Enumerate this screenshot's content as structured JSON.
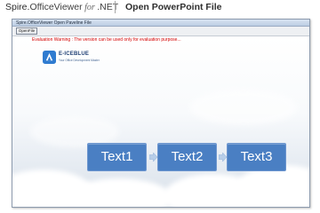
{
  "page": {
    "brand": {
      "part1": "Spire.",
      "part2": "OfficeViewer",
      "part3": " for ",
      "part4": ".NET"
    },
    "title": "Open PowerPoint File"
  },
  "window": {
    "title": "Spire.OfficeViewer Open Paveline File"
  },
  "toolbar": {
    "open_label": "OpenFile"
  },
  "slide": {
    "warning": "Evaluation Warning : The version can be used only for evaluation purpose...",
    "logo_name": "E-ICEBLUE",
    "logo_tagline": "Your Office Development Master",
    "boxes": [
      "Text1",
      "Text2",
      "Text3"
    ]
  },
  "colors": {
    "box_fill": "#4a7fc3",
    "arrow_fill": "#b7cde8",
    "warning_red": "#d40000"
  }
}
